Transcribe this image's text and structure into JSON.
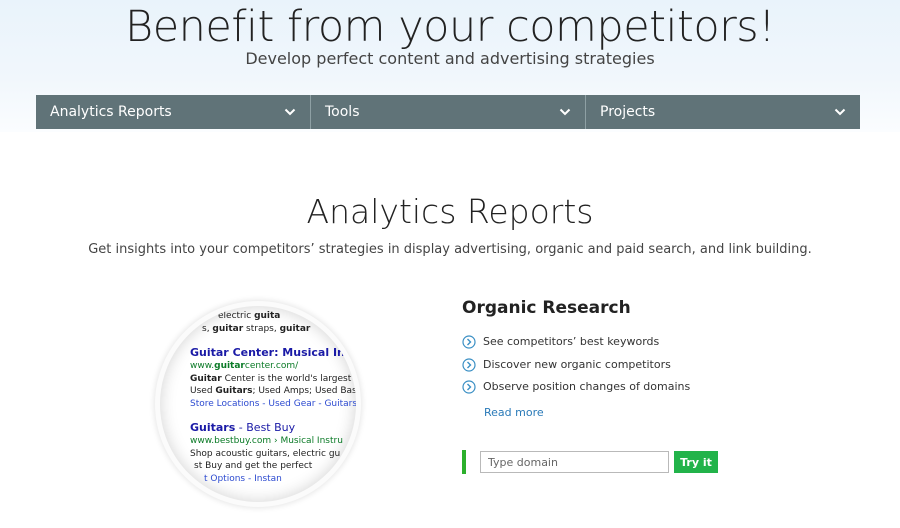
{
  "hero": {
    "title": "Benefit from your competitors!",
    "subtitle": "Develop perfect content and advertising strategies"
  },
  "nav": {
    "items": [
      {
        "label": "Analytics Reports",
        "icon": "chevron-down-icon"
      },
      {
        "label": "Tools",
        "icon": "chevron-down-icon"
      },
      {
        "label": "Projects",
        "icon": "chevron-down-icon"
      }
    ]
  },
  "section": {
    "title": "Analytics Reports",
    "subtitle": "Get insights into your competitors’ strategies in display advertising, organic and paid search, and link building."
  },
  "magnifier": {
    "top_lines": [
      [
        "electric ",
        "guita"
      ],
      [
        "s, ",
        "guitar",
        " straps, ",
        "guitar"
      ]
    ],
    "result1": {
      "title": "Guitar Center: Musical Instru",
      "url_parts": [
        "www.",
        "guitar",
        "center.com/"
      ],
      "line1_parts": [
        "Guitar",
        " Center is the world's largest"
      ],
      "line2_parts": [
        "Used ",
        "Guitars",
        "; Used Amps; Used Bas"
      ],
      "links": "Store Locations - Used Gear - Guitars"
    },
    "result2": {
      "title_bold": "Guitars",
      "title_rest": " - Best Buy",
      "url": "www.bestbuy.com › Musical Instru",
      "line1": "Shop acoustic guitars, electric gu",
      "line2": "st Buy and get the perfect",
      "links": "t Options - Instan"
    }
  },
  "organic": {
    "title": "Organic Research",
    "bullets": [
      "See competitors’ best keywords",
      "Discover new organic competitors",
      "Observe position changes of domains"
    ],
    "bullet_icon": "chevron-right-circle-icon",
    "read_more": "Read more",
    "input_placeholder": "Type domain",
    "button_label": "Try it"
  },
  "colors": {
    "nav_bg": "#607378",
    "accent_green": "#22b34a",
    "link_blue": "#2a7ab8",
    "icon_blue": "#3a8fc4"
  }
}
